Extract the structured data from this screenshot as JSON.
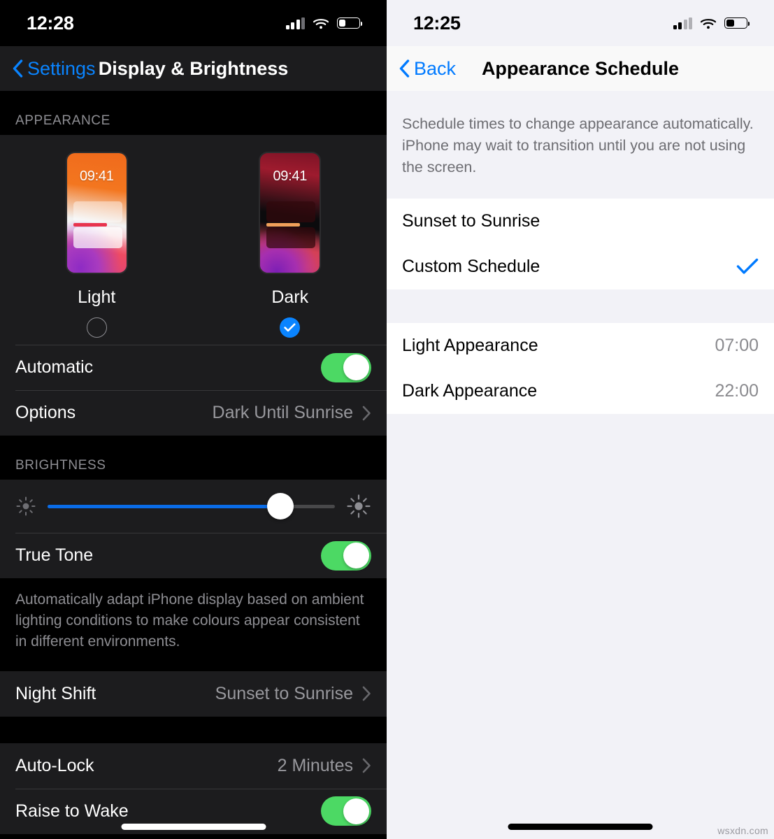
{
  "left_screen": {
    "status_bar": {
      "time": "12:28",
      "cellular_icon": "signal-bars-icon",
      "wifi_icon": "wifi-icon",
      "battery_icon": "battery-icon"
    },
    "nav": {
      "back_label": "Settings",
      "title": "Display & Brightness"
    },
    "appearance": {
      "header": "APPEARANCE",
      "options": [
        {
          "label": "Light",
          "clock": "09:41",
          "selected": false
        },
        {
          "label": "Dark",
          "clock": "09:41",
          "selected": true
        }
      ],
      "automatic": {
        "label": "Automatic",
        "state": "on"
      },
      "options_row": {
        "label": "Options",
        "value": "Dark Until Sunrise"
      }
    },
    "brightness": {
      "header": "BRIGHTNESS",
      "slider": {
        "value_percent": 81,
        "low_icon": "sun-low-icon",
        "high_icon": "sun-high-icon"
      },
      "true_tone": {
        "label": "True Tone",
        "state": "on"
      },
      "footnote": "Automatically adapt iPhone display based on ambient lighting conditions to make colours appear consistent in different environments."
    },
    "night_shift": {
      "label": "Night Shift",
      "value": "Sunset to Sunrise"
    },
    "auto_lock": {
      "label": "Auto-Lock",
      "value": "2 Minutes"
    },
    "raise_to_wake": {
      "label": "Raise to Wake",
      "state": "on"
    }
  },
  "right_screen": {
    "status_bar": {
      "time": "12:25",
      "cellular_icon": "signal-bars-icon",
      "wifi_icon": "wifi-icon",
      "battery_icon": "battery-icon"
    },
    "nav": {
      "back_label": "Back",
      "title": "Appearance Schedule"
    },
    "footnote": "Schedule times to change appearance automatically. iPhone may wait to transition until you are not using the screen.",
    "schedule_options": [
      {
        "label": "Sunset to Sunrise",
        "selected": false
      },
      {
        "label": "Custom Schedule",
        "selected": true
      }
    ],
    "times": [
      {
        "label": "Light Appearance",
        "value": "07:00"
      },
      {
        "label": "Dark Appearance",
        "value": "22:00"
      }
    ]
  },
  "watermark": "wsxdn.com",
  "colors": {
    "accent_blue": "#007aff",
    "accent_blue_dark": "#0a84ff",
    "toggle_green": "#4cd964",
    "slider_blue": "#0a6ce8"
  }
}
